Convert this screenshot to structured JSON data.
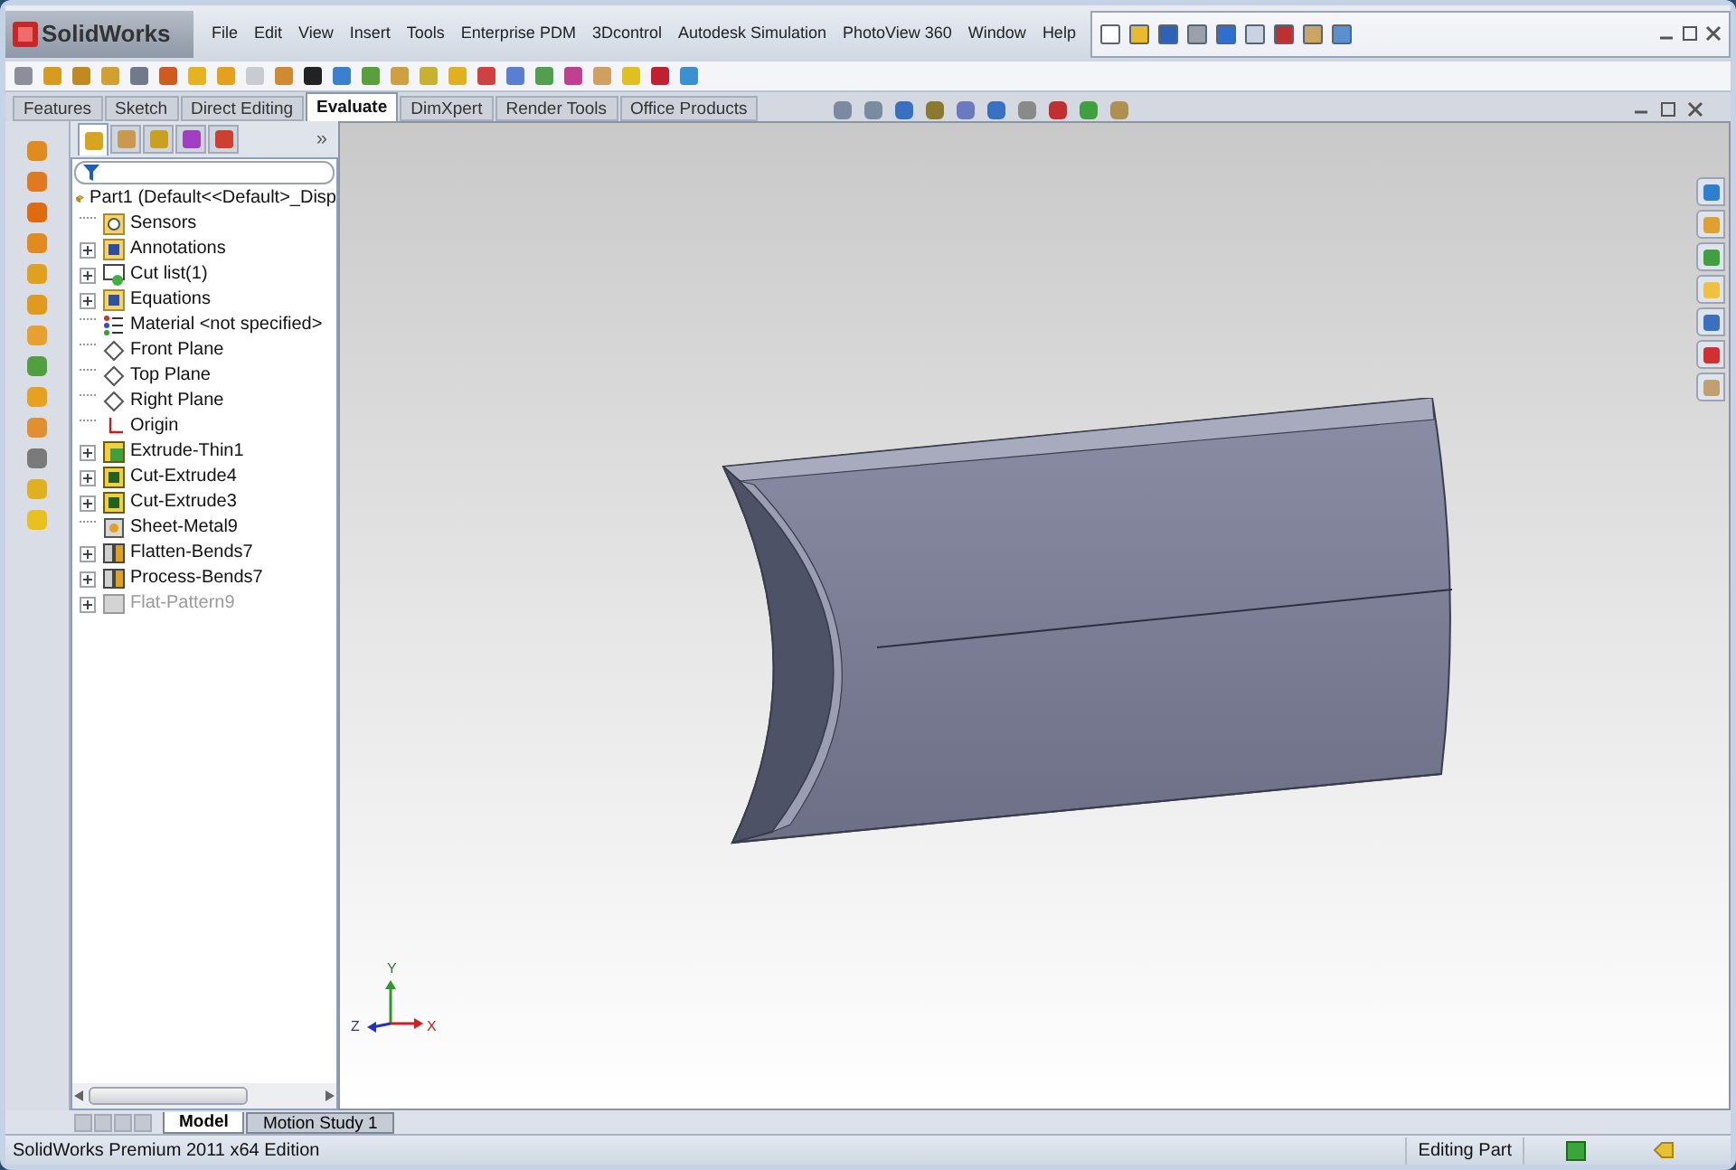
{
  "app": {
    "logo": "SolidWorks"
  },
  "menu": [
    "File",
    "Edit",
    "View",
    "Insert",
    "Tools",
    "Enterprise PDM",
    "3Dcontrol",
    "Autodesk Simulation",
    "PhotoView 360",
    "Window",
    "Help"
  ],
  "command_tabs": [
    {
      "label": "Features",
      "selected": false
    },
    {
      "label": "Sketch",
      "selected": false
    },
    {
      "label": "Direct Editing",
      "selected": false
    },
    {
      "label": "Evaluate",
      "selected": true
    },
    {
      "label": "DimXpert",
      "selected": false
    },
    {
      "label": "Render Tools",
      "selected": false
    },
    {
      "label": "Office Products",
      "selected": false
    }
  ],
  "feature_manager": {
    "tabs": [
      {
        "selected": true
      },
      {
        "selected": false
      },
      {
        "selected": false
      },
      {
        "selected": false
      },
      {
        "selected": false
      }
    ],
    "more": "»",
    "tree": [
      {
        "label": "Part1  (Default<<Default>_Disp",
        "kind": "part",
        "children": [
          {
            "label": "Sensors",
            "kind": "sensors",
            "collapsed": false,
            "suppressed": false
          },
          {
            "label": "Annotations",
            "kind": "annotations",
            "collapsed": true,
            "suppressed": false
          },
          {
            "label": "Cut list(1)",
            "kind": "cutlist",
            "collapsed": true,
            "suppressed": false
          },
          {
            "label": "Equations",
            "kind": "equations",
            "collapsed": true,
            "suppressed": false
          },
          {
            "label": "Material <not specified>",
            "kind": "material",
            "collapsed": false,
            "suppressed": false
          },
          {
            "label": "Front Plane",
            "kind": "plane",
            "collapsed": false,
            "suppressed": false
          },
          {
            "label": "Top Plane",
            "kind": "plane",
            "collapsed": false,
            "suppressed": false
          },
          {
            "label": "Right Plane",
            "kind": "plane",
            "collapsed": false,
            "suppressed": false
          },
          {
            "label": "Origin",
            "kind": "origin",
            "collapsed": false,
            "suppressed": false
          },
          {
            "label": "Extrude-Thin1",
            "kind": "feature",
            "collapsed": true,
            "suppressed": false
          },
          {
            "label": "Cut-Extrude4",
            "kind": "cut",
            "collapsed": true,
            "suppressed": false
          },
          {
            "label": "Cut-Extrude3",
            "kind": "cut",
            "collapsed": true,
            "suppressed": false
          },
          {
            "label": "Sheet-Metal9",
            "kind": "sheetmetal",
            "collapsed": false,
            "suppressed": false
          },
          {
            "label": "Flatten-Bends7",
            "kind": "bends",
            "collapsed": true,
            "suppressed": false
          },
          {
            "label": "Process-Bends7",
            "kind": "bends",
            "collapsed": true,
            "suppressed": false
          },
          {
            "label": "Flat-Pattern9",
            "kind": "flat",
            "collapsed": true,
            "suppressed": true
          }
        ]
      }
    ]
  },
  "triad": {
    "y": "Y",
    "z": "Z",
    "x": "X"
  },
  "bottom_tabs": [
    {
      "label": "Model",
      "selected": true
    },
    {
      "label": "Motion Study 1",
      "selected": false
    }
  ],
  "status_bar": {
    "edition": "SolidWorks Premium 2011 x64 Edition",
    "mode": "Editing Part"
  }
}
